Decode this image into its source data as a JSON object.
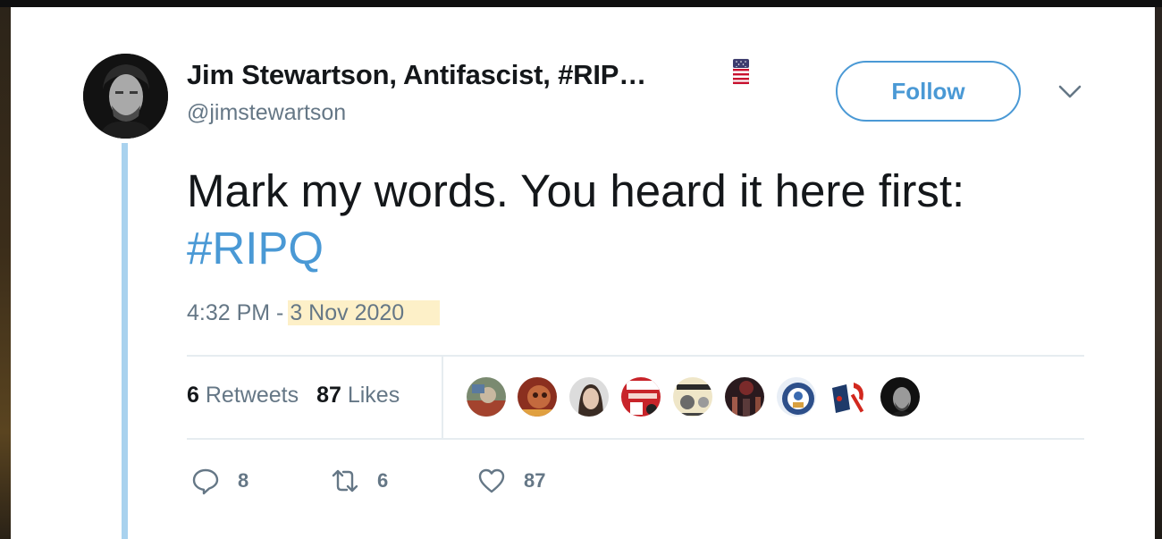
{
  "tweet": {
    "display_name": "Jim Stewartson, Antifascist, #RIP…",
    "handle": "@jimstewartson",
    "follow_label": "Follow",
    "text_line1": "Mark my words. You heard it here first:",
    "hashtag": "#RIPQ",
    "time": "4:32 PM - ",
    "date": "3 Nov 2020",
    "retweets_count": "6",
    "retweets_label": "Retweets",
    "likes_count": "87",
    "likes_label": "Likes",
    "reply_count": "8",
    "retweet_action_count": "6",
    "like_action_count": "87"
  },
  "colors": {
    "accent": "#4a99d5",
    "text": "#14171a",
    "muted": "#657786",
    "thread_line": "#a9d2ee",
    "date_highlight": "#fdf0c8"
  },
  "icons": {
    "flag": "us-flag-icon",
    "more": "chevron-down-icon",
    "reply": "reply-icon",
    "retweet": "retweet-icon",
    "like": "heart-icon"
  }
}
